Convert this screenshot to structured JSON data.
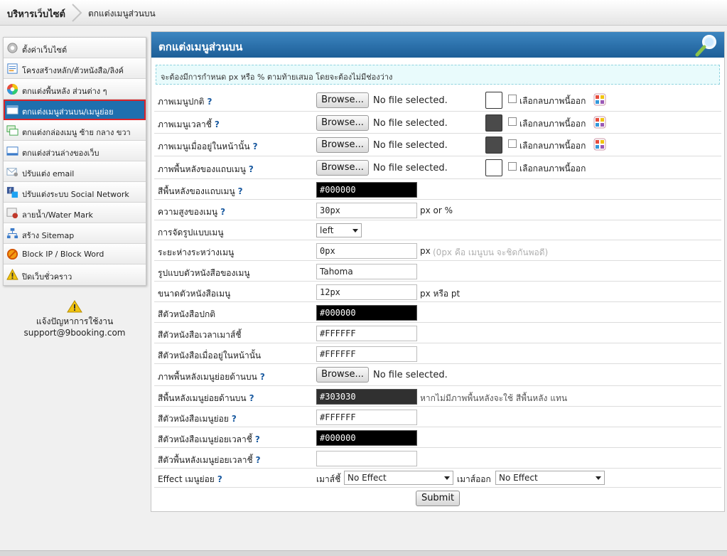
{
  "breadcrumb": {
    "home": "บริหารเว็บไซต์",
    "current": "ตกแต่งเมนูส่วนบน"
  },
  "sidebar": {
    "items": [
      {
        "label": "ตั้งค่าเว็บไซต์",
        "icon": "gear-icon",
        "color": "#b8b8b8"
      },
      {
        "label": "โครงสร้างหลัก/ตัวหนังสือ/ลิงค์",
        "icon": "edit-document-icon",
        "color": "#3b7bc9"
      },
      {
        "label": "ตกแต่งพื้นหลัง ส่วนต่าง ๆ",
        "icon": "color-wheel-icon",
        "color": "#e9a23b"
      },
      {
        "label": "ตกแต่งเมนูส่วนบน/เมนูย่อย",
        "icon": "window-icon",
        "color": "#ffffff"
      },
      {
        "label": "ตกแต่งกล่องเมนู ซ้าย กลาง ขวา",
        "icon": "windows-stack-icon",
        "color": "#3fa54b"
      },
      {
        "label": "ตกแต่งส่วนล่างของเว็บ",
        "icon": "window-bottom-icon",
        "color": "#3b7bc9"
      },
      {
        "label": "ปรับแต่ง email",
        "icon": "email-settings-icon",
        "color": "#8aa7c4"
      },
      {
        "label": "ปรับแต่งระบบ Social Network",
        "icon": "social-network-icon",
        "color": "#3b5998"
      },
      {
        "label": "ลายน้ำ/Water Mark",
        "icon": "watermark-icon",
        "color": "#c0392b"
      },
      {
        "label": "สร้าง Sitemap",
        "icon": "sitemap-icon",
        "color": "#3b7bc9"
      },
      {
        "label": "Block IP / Block Word",
        "icon": "block-icon",
        "color": "#d35400"
      },
      {
        "label": "ปิดเว็บชั่วคราว",
        "icon": "warning-icon",
        "color": "#e0a800"
      }
    ],
    "active_index": 3
  },
  "support": {
    "label": "แจ้งปัญหาการใช้งาน",
    "email": "support@9booking.com",
    "icon": "warning-icon"
  },
  "panel": {
    "title": "ตกแต่งเมนูส่วนบน",
    "notice": "จะต้องมีการกำหนด px หรือ % ตามท้ายเสมอ โดยจะต้องไม่มีช่องว่าง",
    "q": "?",
    "browse_label": "Browse...",
    "no_file": "No file selected.",
    "remove_label": "เลือกลบภาพนี้ออก",
    "file_rows": [
      {
        "label": "ภาพเมนูปกติ",
        "swatch": "#ffffff",
        "palette": true
      },
      {
        "label": "ภาพเมนูเวลาชี้",
        "swatch": "#4a4a4a",
        "palette": true
      },
      {
        "label": "ภาพเมนูเมื่ออยู่ในหน้านั้น",
        "swatch": "#4a4a4a",
        "palette": true
      },
      {
        "label": "ภาพพื้นหลังของแถบเมนู",
        "swatch": "#ffffff",
        "palette": false
      }
    ],
    "menu_bg_color": {
      "label": "สีพื้นหลังของแถบเมนู",
      "value": "#000000"
    },
    "menu_height": {
      "label": "ความสูงของเมนู",
      "value": "30px",
      "unit": "px or %"
    },
    "menu_align": {
      "label": "การจัดรูปแบบเมนู",
      "value": "left"
    },
    "menu_spacing": {
      "label": "ระยะห่างระหว่างเมนู",
      "value": "0px",
      "unit": "px",
      "hint": "(0px คือ เมนูบน จะชิดกันพอดี)"
    },
    "menu_font": {
      "label": "รูปแบบตัวหนังสือของเมนู",
      "value": "Tahoma"
    },
    "menu_font_size": {
      "label": "ขนาดตัวหนังสือเมนู",
      "value": "12px",
      "unit": "px หรือ pt"
    },
    "text_color_normal": {
      "label": "สีตัวหนังสือปกติ",
      "value": "#000000"
    },
    "text_color_hover": {
      "label": "สีตัวหนังสือเวลาเมาส์ชี้",
      "value": "#FFFFFF"
    },
    "text_color_active": {
      "label": "สีตัวหนังสือเมื่ออยู่ในหน้านั้น",
      "value": "#FFFFFF"
    },
    "submenu_bg_image": {
      "label": "ภาพพื้นหลังเมนูย่อยด้านบน"
    },
    "submenu_bg_color": {
      "label": "สีพื้นหลังเมนูย่อยด้านบน",
      "value": "#303030",
      "hint": "หากไม่มีภาพพื้นหลังจะใช้ สีพื้นหลัง แทน"
    },
    "submenu_text_color": {
      "label": "สีตัวหนังสือเมนูย่อย",
      "value": "#FFFFFF"
    },
    "submenu_text_hover": {
      "label": "สีตัวหนังสือเมนูย่อยเวลาชี้",
      "value": "#000000"
    },
    "submenu_bg_hover": {
      "label": "สีตัวพื้นหลังเมนูย่อยเวลาชี้",
      "value": ""
    },
    "submenu_effect": {
      "label": "Effect เมนูย่อย",
      "hover_label": "เมาส์ชี้",
      "hover_value": "No Effect",
      "out_label": "เมาส์ออก",
      "out_value": "No Effect"
    },
    "submit_label": "Submit"
  }
}
